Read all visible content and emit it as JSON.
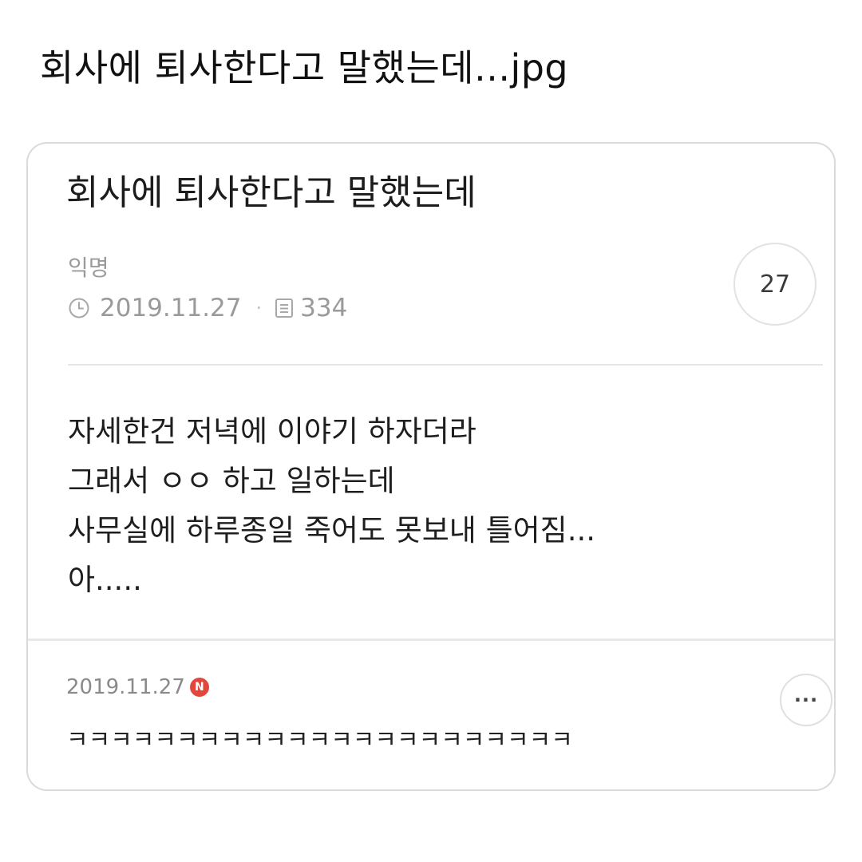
{
  "headline": "회사에 퇴사한다고 말했는데...jpg",
  "post": {
    "title": "회사에 퇴사한다고 말했는데",
    "author": "익명",
    "date": "2019.11.27",
    "separator": "·",
    "views": "334",
    "comment_count": "27",
    "body_lines": [
      "자세한건 저녁에 이야기 하자더라",
      "그래서 ㅇㅇ 하고 일하는데",
      "사무실에 하루종일 죽어도 못보내 틀어짐...",
      "아....."
    ]
  },
  "comment": {
    "date": "2019.11.27",
    "new_badge": "N",
    "more_label": "···",
    "text": "ㅋㅋㅋㅋㅋㅋㅋㅋㅋㅋㅋㅋㅋㅋㅋㅋㅋㅋㅋㅋㅋㅋㅋ"
  },
  "icons": {
    "clock": "clock-icon",
    "views": "document-icon",
    "new": "new-badge-icon",
    "more": "more-icon"
  },
  "colors": {
    "meta_gray": "#9a9a9a",
    "new_badge": "#e2463c",
    "border": "#dadada"
  }
}
